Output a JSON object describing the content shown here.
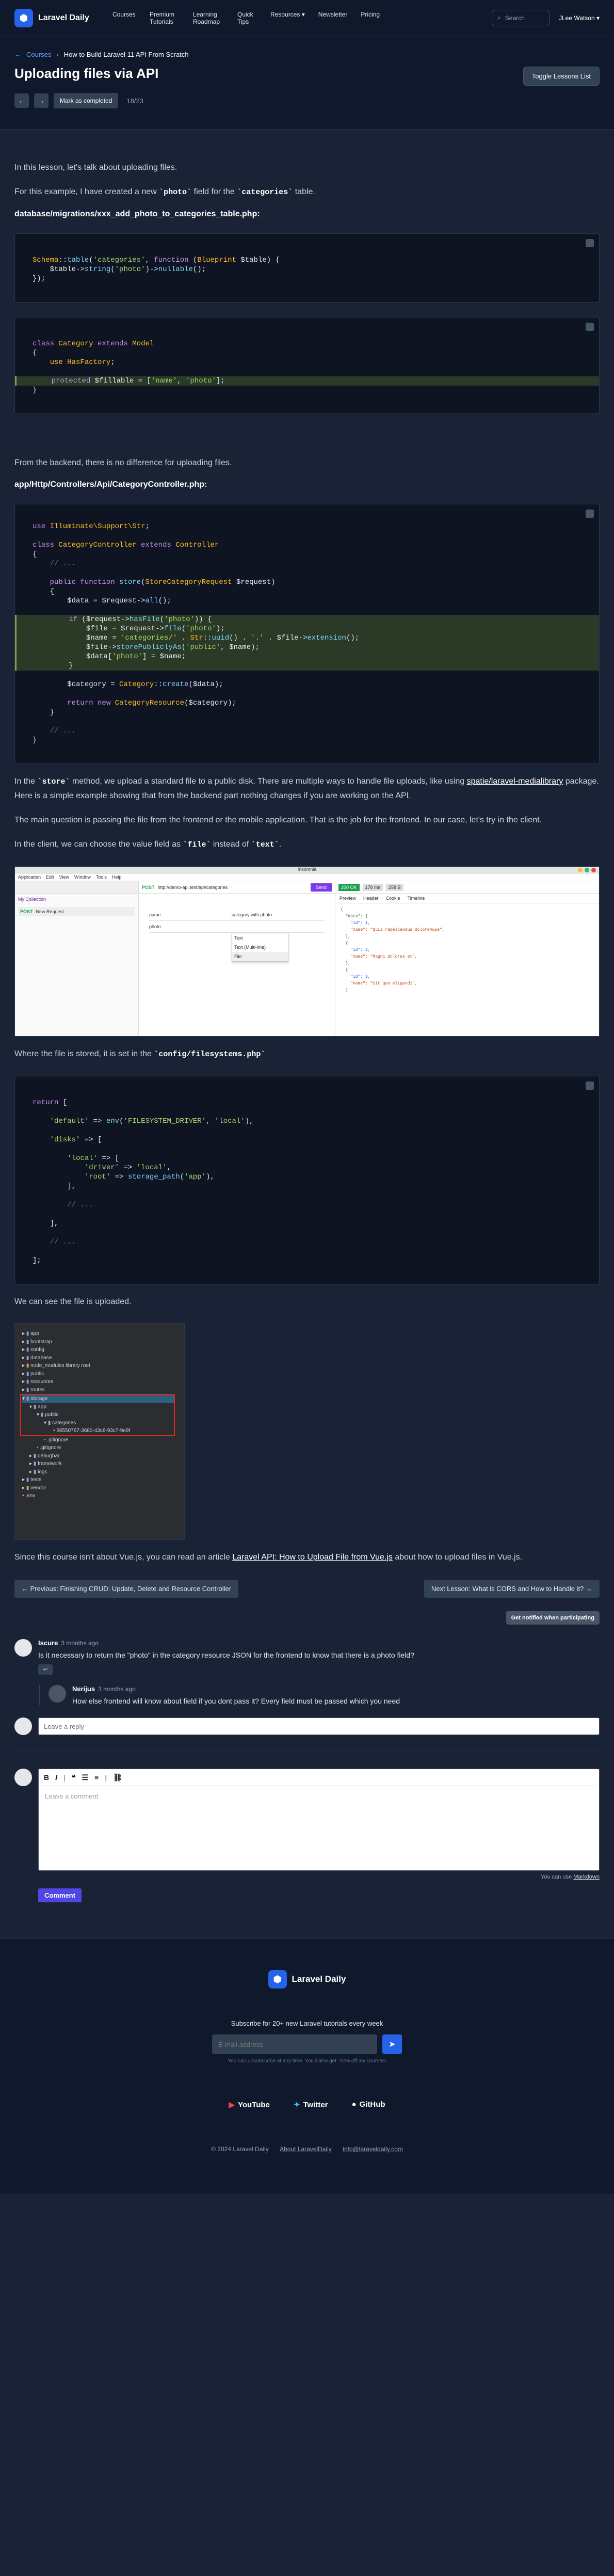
{
  "nav": {
    "brand": "Laravel Daily",
    "items": [
      "Courses",
      "Premium Tutorials",
      "Learning Roadmap",
      "Quick Tips",
      "Resources ▾",
      "Newsletter",
      "Pricing"
    ],
    "search_label": "Search",
    "user_label": "JLee Watson ▾"
  },
  "lesson": {
    "breadcrumb_root": "Courses",
    "breadcrumb_course": "How to Build Laravel 11 API From Scratch",
    "title": "Uploading files via API",
    "toggle_label": "Toggle Lessons List",
    "mark_label": "Mark as completed",
    "counter": "18/23"
  },
  "content": {
    "p1": "In this lesson, let's talk about uploading files.",
    "p2a": "For this example, I have created a new ",
    "p2b": "photo",
    "p2c": " field for the ",
    "p2d": "categories",
    "p2e": " table.",
    "file1": "database/migrations/xxx_add_photo_to_categories_table.php:",
    "p3": "From the backend, there is no difference for uploading files.",
    "file2": "app/Http/Controllers/Api/CategoryController.php:",
    "p4a": "In the ",
    "p4b": "store",
    "p4c": " method, we upload a standard file to a public disk. There are multiple ways to handle file uploads, like using ",
    "p4d": "spatie/laravel-medialibrary",
    "p4e": " package. Here is a simple example showing that from the backend part nothing changes if you are working on the API.",
    "p5": "The main question is passing the file from the frontend or the mobile application. That is the job for the frontend. In our case, let's try in the client.",
    "p6a": "In the client, we can choose the value field as ",
    "p6b": "file",
    "p6c": " instead of ",
    "p6d": "text",
    "p6e": ".",
    "p7a": "Where the file is stored, it is set in the ",
    "p7b": "config/filesystems.php",
    "p8": "We can see the file is uploaded.",
    "p9a": "Since this course isn't about Vue.js, you can read an article ",
    "p9b": "Laravel API: How to Upload File from Vue.js",
    "p9c": " about how to upload files in Vue.js."
  },
  "code1": [
    "Schema::table('categories', function (Blueprint $table) {",
    "    $table->string('photo')->nullable();",
    "});"
  ],
  "code2": [
    "class Category extends Model",
    "{",
    "    use HasFactory;",
    "",
    "    protected $fillable = ['name', 'photo'];",
    "}"
  ],
  "code3": [
    "use Illuminate\\Support\\Str;",
    "",
    "class CategoryController extends Controller",
    "{",
    "    // ...",
    "",
    "    public function store(StoreCategoryRequest $request)",
    "    {",
    "        $data = $request->all();",
    "",
    "        if ($request->hasFile('photo')) {",
    "            $file = $request->file('photo');",
    "            $name = 'categories/' . Str::uuid() . '.' . $file->extension();",
    "            $file->storePubliclyAs('public', $name);",
    "            $data['photo'] = $name;",
    "        }",
    "",
    "        $category = Category::create($data);",
    "",
    "        return new CategoryResource($category);",
    "    }",
    "",
    "    // ...",
    "}"
  ],
  "code4": [
    "return [",
    "",
    "    'default' => env('FILESYSTEM_DRIVER', 'local'),",
    "",
    "    'disks' => [",
    "",
    "        'local' => [",
    "            'driver' => 'local',",
    "            'root' => storage_path('app'),",
    "        ],",
    "",
    "        // ...",
    "",
    "    ],",
    "",
    "    // ...",
    "",
    "];"
  ],
  "insomnia": {
    "title": "Insomnia",
    "menus": [
      "Application",
      "Edit",
      "View",
      "Window",
      "Tools",
      "Help"
    ],
    "method": "POST",
    "url": "http://demo-api.test/api/categories",
    "send": "Send",
    "status": "200 OK",
    "time": "178 ms",
    "size": "258 B",
    "fields": [
      "name",
      "photo"
    ],
    "field_values": [
      "category with photo",
      ""
    ],
    "dropdown": [
      "Text",
      "Text (Multi-line)",
      "File"
    ],
    "collection": "My Collection",
    "request": "New Request",
    "response_tabs": [
      "Preview",
      "Header",
      "Cookie",
      "Timeline"
    ],
    "json_lines": [
      "{",
      "  \"data\": {",
      "    \"id\": 1,",
      "    \"name\": \"Quia repellendus doloremque\",",
      "  },",
      "  {",
      "    \"id\": 2,",
      "    \"name\": \"Magni dolores et\",",
      "  },",
      "  {",
      "    \"id\": 3,",
      "    \"name\": \"Sit quo eligendi\",",
      "  }"
    ]
  },
  "tree": {
    "items": [
      "app",
      "bootstrap",
      "config",
      "database",
      "node_modules  library root",
      "public",
      "resources",
      "routes",
      "storage",
      "app",
      "public",
      "categories",
      "66550767-3680-43c6-93c7-9e9f",
      ".gitignore",
      ".gitignore",
      "debugbar",
      "framework",
      "logs",
      "tests",
      "vendor",
      ".env"
    ]
  },
  "pager": {
    "prev": "← Previous: Finishing CRUD: Update, Delete and Resource Controller",
    "next": "Next Lesson: What is CORS and How to Handle it? →",
    "notify": "Get notified when participating"
  },
  "comments": [
    {
      "author": "Iscure",
      "date": "3 months ago",
      "text": "Is it necessary to return the \"photo\" in the category resource JSON for the frontend to know that there is a photo field?"
    }
  ],
  "reply": {
    "author": "Nerijus",
    "date": "3 months ago",
    "text": "How else frontend will know about field if you dont pass it? Every field must be passed which you need"
  },
  "reply_placeholder": "Leave a reply",
  "editor": {
    "tools": [
      "B",
      "I",
      "❝",
      "☰",
      "≡",
      "⛓"
    ],
    "placeholder": "Leave a comment",
    "md_prefix": "You can use ",
    "md_link": "Markdown",
    "submit": "Comment"
  },
  "footer": {
    "brand": "Laravel Daily",
    "sub_title": "Subscribe for 20+ new Laravel tutorials every week",
    "email_placeholder": "E-mail address",
    "note": "You can unsubscribe at any time. You'll also get -20% off my courses!",
    "social": [
      "YouTube",
      "Twitter",
      "GitHub"
    ],
    "copyright": "© 2024 Laravel Daily",
    "link1": "About LaravelDaily",
    "link2": "info@laraveldaily.com"
  },
  "colors": {
    "accent": "#2563eb",
    "comment_button": "#4f46e5",
    "youtube": "#ef4444"
  }
}
